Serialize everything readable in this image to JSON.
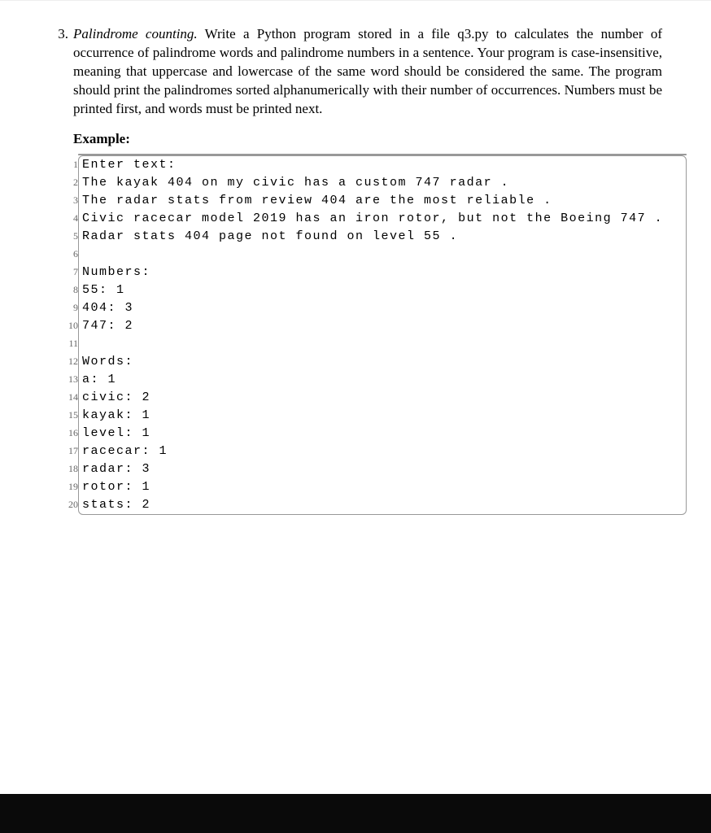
{
  "problem": {
    "number": "3.",
    "title_italic": "Palindrome counting.",
    "body_rest": " Write a Python program stored in a file q3.py to calculates the number of occurrence of palindrome words and palindrome numbers in a sentence. Your program is case-insensitive, meaning that uppercase and lowercase of the same word should be considered the same. The program should print the palindromes sorted alphanumerically with their number of occurrences. Numbers must be printed first, and words must be printed next.",
    "example_label": "Example:"
  },
  "code": {
    "lines": [
      {
        "n": "1",
        "t": "Enter text:"
      },
      {
        "n": "2",
        "t": "The kayak 404 on my civic has a custom 747 radar ."
      },
      {
        "n": "3",
        "t": "The radar stats from review 404 are the most reliable ."
      },
      {
        "n": "4",
        "t": "Civic racecar model 2019 has an iron rotor, but not the Boeing 747 ."
      },
      {
        "n": "5",
        "t": "Radar stats 404 page not found on level 55 ."
      },
      {
        "n": "6",
        "t": ""
      },
      {
        "n": "7",
        "t": "Numbers:"
      },
      {
        "n": "8",
        "t": "55: 1"
      },
      {
        "n": "9",
        "t": "404: 3"
      },
      {
        "n": "10",
        "t": "747: 2"
      },
      {
        "n": "11",
        "t": ""
      },
      {
        "n": "12",
        "t": "Words:"
      },
      {
        "n": "13",
        "t": "a: 1"
      },
      {
        "n": "14",
        "t": "civic: 2"
      },
      {
        "n": "15",
        "t": "kayak: 1"
      },
      {
        "n": "16",
        "t": "level: 1"
      },
      {
        "n": "17",
        "t": "racecar: 1"
      },
      {
        "n": "18",
        "t": "radar: 3"
      },
      {
        "n": "19",
        "t": "rotor: 1"
      },
      {
        "n": "20",
        "t": "stats: 2"
      }
    ]
  }
}
